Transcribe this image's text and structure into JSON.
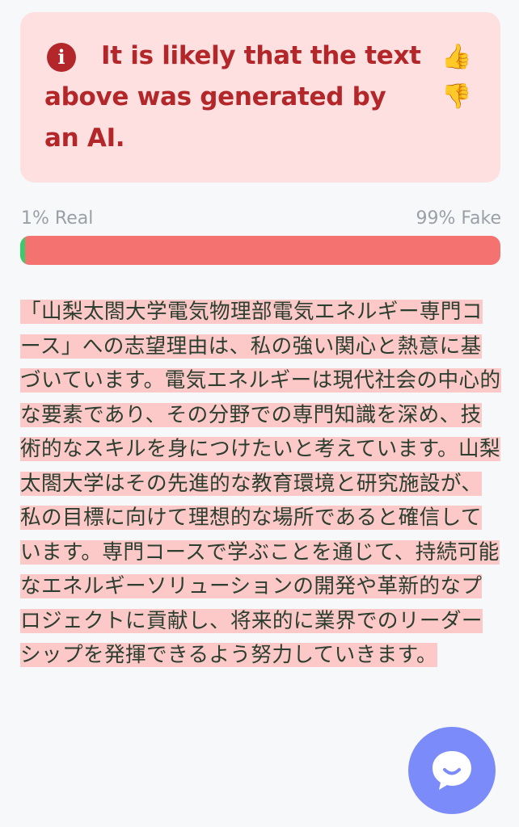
{
  "alert": {
    "message": "It is likely that the text above was generated by an AI.",
    "info_icon": "info-circle-icon",
    "thumbs_up_icon": "thumbs-up-icon",
    "thumbs_down_icon": "thumbs-down-icon",
    "text_color": "#b3262a",
    "background": "#fde0df"
  },
  "score": {
    "real_label": "1% Real",
    "fake_label": "99% Fake",
    "real_fraction": 0.01,
    "fake_fraction": 0.99,
    "real_color": "#3ccb6a",
    "fake_color": "#f4726f"
  },
  "analyzed_text": "「山梨太閤大学電気物理部電気エネルギー専門コース」への志望理由は、私の強い関心と熱意に基づいています。電気エネルギーは現代社会の中心的な要素であり、その分野での専門知識を深め、技術的なスキルを身につけたいと考えています。山梨太閤大学はその先進的な教育環境と研究施設が、私の目標に向けて理想的な場所であると確信しています。専門コースで学ぶことを通じて、持続可能なエネルギーソリューションの開発や革新的なプロジェクトに貢献し、将来的に業界でのリーダーシップを発揮できるよう努力していきます。",
  "chat": {
    "icon": "chat-bubble-icon",
    "color": "#7b8cfa"
  }
}
